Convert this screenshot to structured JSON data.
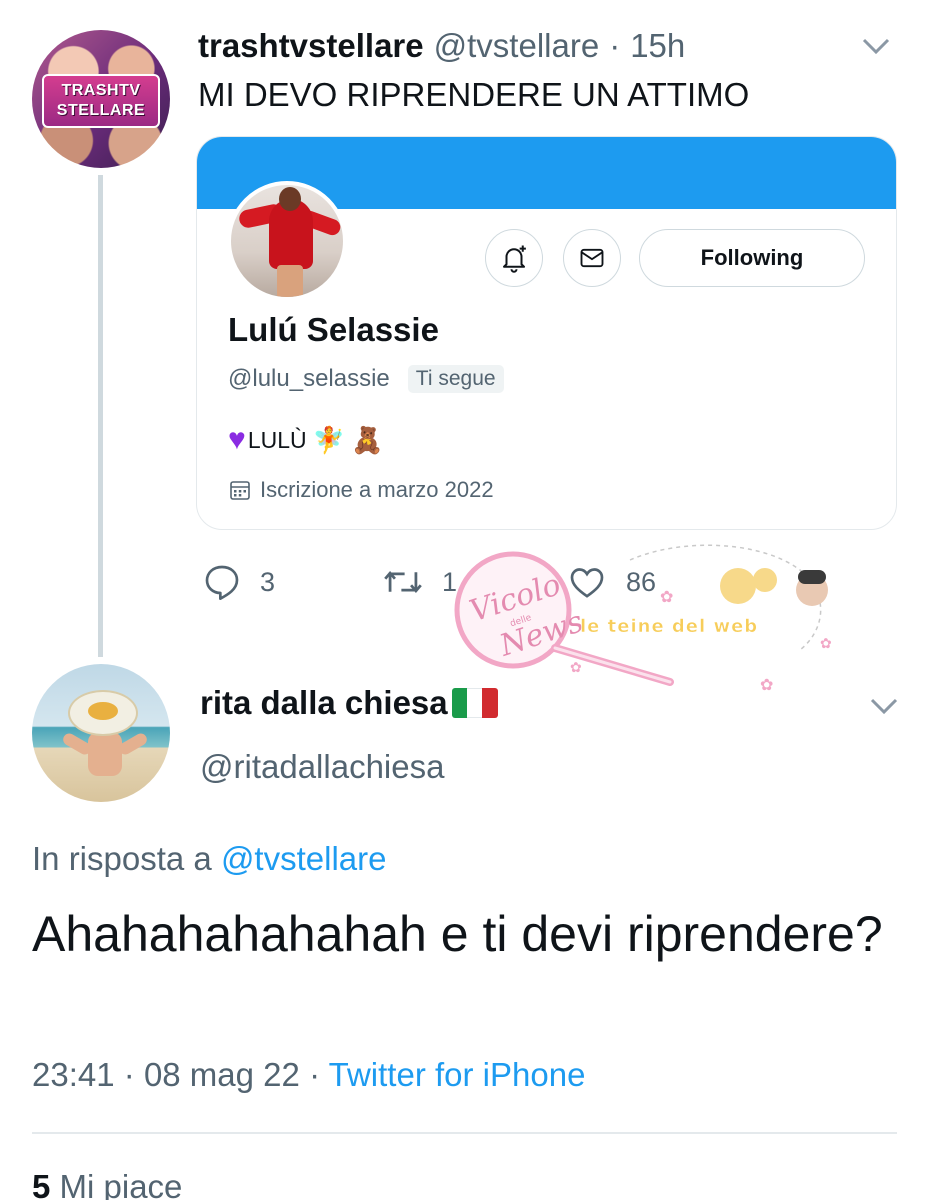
{
  "tweet1": {
    "avatar_text_line1": "TRASHTV",
    "avatar_text_line2": "STELLARE",
    "display_name": "trashtvstellare",
    "handle": "@tvstellare",
    "separator": "·",
    "time": "15h",
    "text": "MI DEVO RIPRENDERE UN ATTIMO",
    "card": {
      "following_label": "Following",
      "name": "Lulú Selassie",
      "handle": "@lulu_selassie",
      "follows_you": "Ti segue",
      "bio_text": "LULÙ",
      "joined": "Iscrizione a marzo 2022",
      "banner_color": "#1d9bf0"
    },
    "actions": {
      "replies": "3",
      "retweets": "1",
      "likes": "86"
    }
  },
  "watermark": {
    "text_main": "Vicolo",
    "text_small": "delle",
    "text_end": "News",
    "text_right": "le teine del web"
  },
  "tweet2": {
    "display_name": "rita dalla chiesa",
    "handle": "@ritadallachiesa",
    "reply_prefix": "In risposta a ",
    "reply_mention": "@tvstellare",
    "text": "Ahahahahahahah e ti devi riprendere?",
    "time": "23:41",
    "separator": "·",
    "date": "08 mag 22",
    "separator2": "·",
    "source": "Twitter for iPhone",
    "likes_count": "5",
    "likes_label": "Mi piace"
  },
  "colors": {
    "accent": "#1d9bf0",
    "secondary_text": "#536471",
    "primary_text": "#0f1419"
  }
}
